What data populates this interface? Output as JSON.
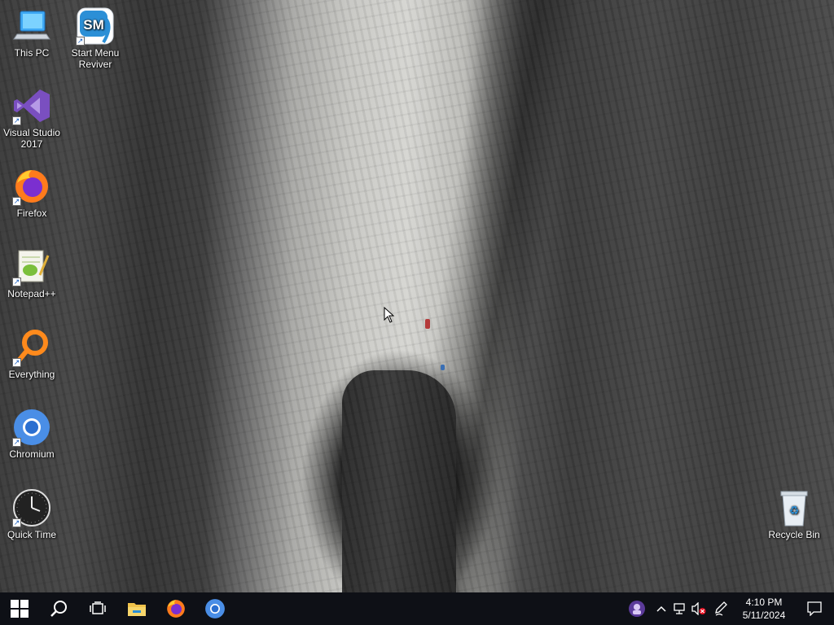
{
  "desktop": {
    "icons": [
      {
        "label": "This PC",
        "icon": "this-pc-icon"
      },
      {
        "label": "Start Menu Reviver",
        "icon": "start-menu-reviver-icon",
        "badge": "SM"
      },
      {
        "label": "Visual Studio 2017",
        "icon": "visual-studio-icon"
      },
      {
        "label": "Firefox",
        "icon": "firefox-icon"
      },
      {
        "label": "Notepad++",
        "icon": "notepad-plus-plus-icon"
      },
      {
        "label": "Everything",
        "icon": "everything-search-icon"
      },
      {
        "label": "Chromium",
        "icon": "chromium-icon"
      },
      {
        "label": "Quick Time",
        "icon": "quick-time-clock-icon"
      },
      {
        "label": "Recycle Bin",
        "icon": "recycle-bin-icon"
      }
    ]
  },
  "taskbar": {
    "pinned": [
      "windows-start-icon",
      "search-icon",
      "task-view-icon",
      "file-explorer-icon",
      "firefox-icon",
      "chromium-icon"
    ],
    "tray": {
      "icons": [
        "app-tray-icon",
        "show-hidden-icons-chevron",
        "network-icon",
        "volume-muted-icon",
        "pen-icon"
      ],
      "time": "4:10 PM",
      "date": "5/11/2024"
    }
  },
  "colors": {
    "taskbar_bg": "#0e1016",
    "accent_blue": "#2b7de9"
  }
}
